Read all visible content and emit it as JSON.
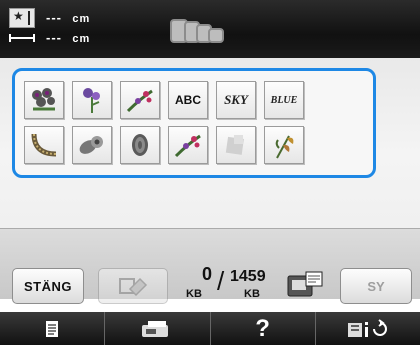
{
  "header": {
    "height_value": "---",
    "height_unit": "cm",
    "width_value": "---",
    "width_unit": "cm",
    "icons": [
      "pattern-size-icon",
      "width-arrow-icon",
      "embroidery-frames-icon"
    ]
  },
  "patterns": [
    {
      "type": "icon",
      "name": "flower-bouquet-pattern"
    },
    {
      "type": "icon",
      "name": "flower-sprig-pattern"
    },
    {
      "type": "icon",
      "name": "floral-spray-pattern"
    },
    {
      "type": "text",
      "label": "ABC",
      "name": "abc-lettering-pattern"
    },
    {
      "type": "text",
      "label": "SKY",
      "name": "sky-lettering-pattern"
    },
    {
      "type": "text",
      "label": "BLUE",
      "name": "blue-lettering-pattern"
    },
    {
      "type": "icon",
      "name": "curved-border-pattern"
    },
    {
      "type": "icon",
      "name": "leaf-flower-pattern"
    },
    {
      "type": "icon",
      "name": "oval-ornament-pattern"
    },
    {
      "type": "icon",
      "name": "floral-spray-2-pattern"
    },
    {
      "type": "icon",
      "name": "faded-patch-pattern"
    },
    {
      "type": "icon",
      "name": "lily-pattern"
    }
  ],
  "controls": {
    "close_label": "STÄNG",
    "sew_label": "SY",
    "memory_used": "0",
    "memory_total": "1459",
    "memory_unit": "KB"
  },
  "nav": [
    "page-icon",
    "machine-icon",
    "help-icon",
    "settings-icon"
  ],
  "colors": {
    "accent": "#1e88e5",
    "topbar": "#1a1a1a",
    "background": "#f0f0f0"
  }
}
